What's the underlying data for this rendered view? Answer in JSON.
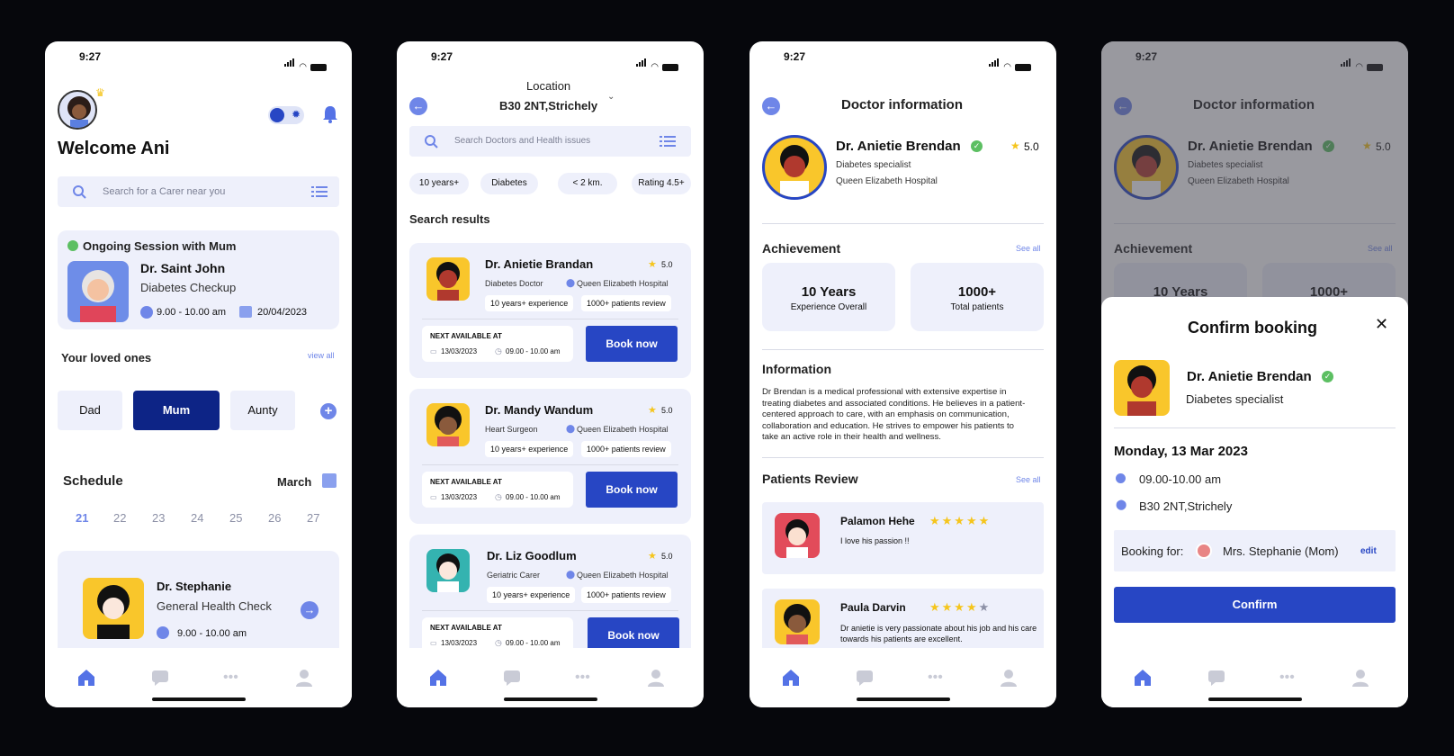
{
  "status_time": "9:27",
  "home": {
    "welcome": "Welcome Ani",
    "search_placeholder": "Search for a Carer near you",
    "ongoing": {
      "title": "Ongoing Session with Mum",
      "doctor": "Dr. Saint John",
      "purpose": "Diabetes Checkup",
      "time": "9.00 - 10.00 am",
      "date": "20/04/2023"
    },
    "loved_ones_title": "Your loved ones",
    "view_all": "view all",
    "loved_ones": [
      "Dad",
      "Mum",
      "Aunty"
    ],
    "schedule_title": "Schedule",
    "month": "March",
    "days": [
      "21",
      "22",
      "23",
      "24",
      "25",
      "26",
      "27"
    ],
    "appointment": {
      "doctor": "Dr. Stephanie",
      "purpose": "General Health Check",
      "time": "9.00 - 10.00 am"
    }
  },
  "search_screen": {
    "location_label": "Location",
    "location_value": "B30 2NT,Strichely",
    "search_placeholder": "Search Doctors and Health issues",
    "filters": [
      "10 years+",
      "Diabetes",
      "< 2 km.",
      "Rating 4.5+"
    ],
    "results_title": "Search results",
    "next_label": "NEXT AVAILABLE AT",
    "book_label": "Book now",
    "results": [
      {
        "name": "Dr. Anietie Brandan",
        "rating": "5.0",
        "role": "Diabetes Doctor",
        "hospital": "Queen Elizabeth Hospital",
        "experience": "10 years+ experience",
        "reviews": "1000+ patients review",
        "date": "13/03/2023",
        "time": "09.00 - 10.00 am"
      },
      {
        "name": "Dr. Mandy Wandum",
        "rating": "5.0",
        "role": "Heart Surgeon",
        "hospital": "Queen Elizabeth Hospital",
        "experience": "10 years+ experience",
        "reviews": "1000+ patients review",
        "date": "13/03/2023",
        "time": "09.00 - 10.00 am"
      },
      {
        "name": "Dr. Liz Goodlum",
        "rating": "5.0",
        "role": "Geriatric Carer",
        "hospital": "Queen Elizabeth Hospital",
        "experience": "10 years+ experience",
        "reviews": "1000+ patients review",
        "date": "13/03/2023",
        "time": "09.00 - 10.00 am"
      }
    ]
  },
  "doctor_info": {
    "title": "Doctor information",
    "name": "Dr. Anietie Brendan",
    "rating": "5.0",
    "specialty": "Diabetes specialist",
    "hospital": "Queen Elizabeth Hospital",
    "achievement_title": "Achievement",
    "see_all": "See all",
    "stat1_value": "10 Years",
    "stat1_label": "Experience Overall",
    "stat2_value": "1000+",
    "stat2_label": "Total patients",
    "information_title": "Information",
    "information_text": "Dr Brendan is a medical professional with extensive expertise in treating diabetes and associated conditions. He believes in a patient-centered approach to care, with an emphasis on communication, collaboration and education. He strives to empower his patients to take an active role in their health and wellness.",
    "reviews_title": "Patients Review",
    "reviews": [
      {
        "name": "Palamon Hehe",
        "text": "I love his passion !!",
        "stars": 5
      },
      {
        "name": "Paula Darvin",
        "text": "Dr anietie is very passionate about his job and his care towards his patients are excellent.",
        "stars": 4
      }
    ]
  },
  "booking": {
    "title": "Confirm booking",
    "doctor": "Dr. Anietie Brendan",
    "specialty": "Diabetes specialist",
    "date": "Monday, 13 Mar 2023",
    "time": "09.00-10.00 am",
    "location": "B30 2NT,Strichely",
    "booking_for_label": "Booking for:",
    "booking_for": "Mrs. Stephanie (Mom)",
    "edit": "edit",
    "confirm": "Confirm"
  },
  "colors": {
    "accent": "#2746c4",
    "light": "#eef0fb",
    "icon": "#6f86e8",
    "star": "#f5c51c",
    "verified": "#5cbf62"
  }
}
